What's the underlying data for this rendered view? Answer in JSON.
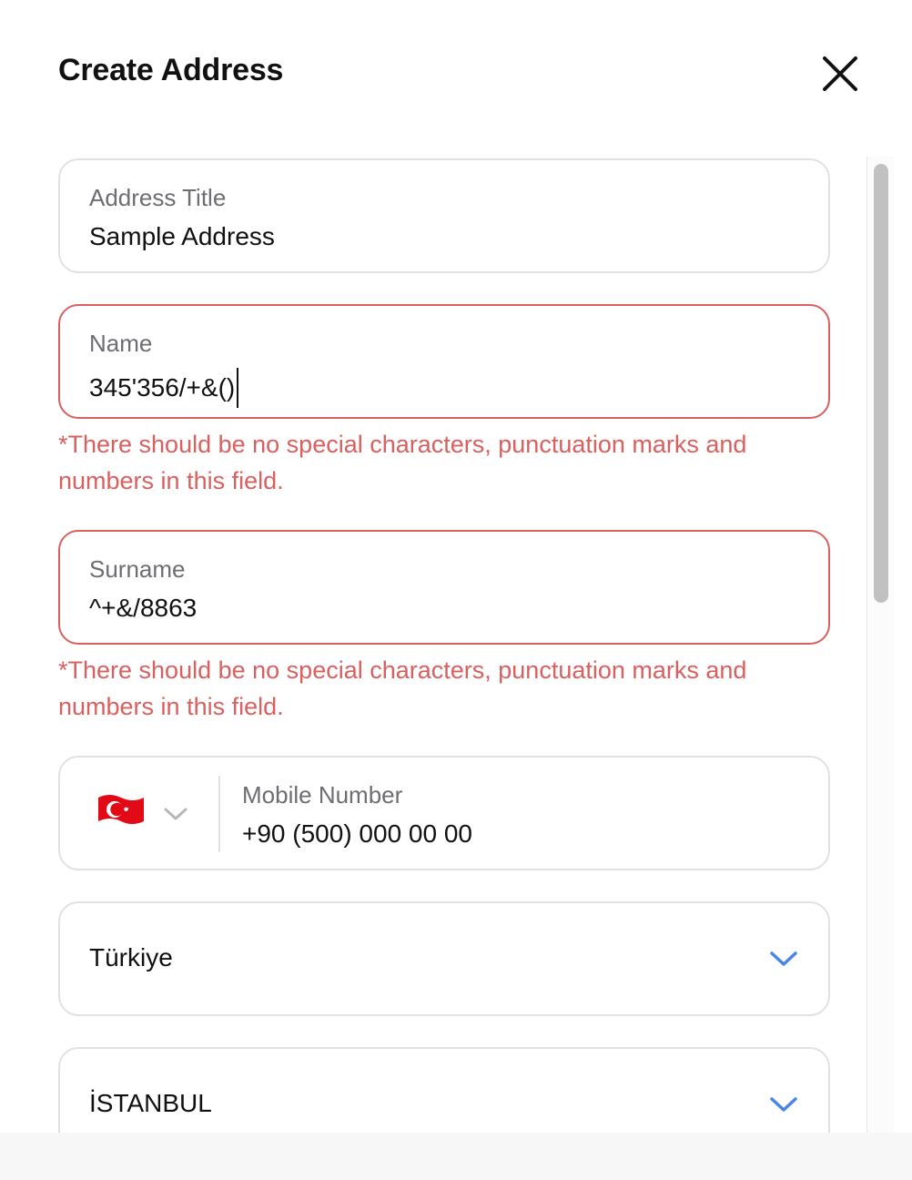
{
  "header": {
    "title": "Create Address"
  },
  "form": {
    "address_title": {
      "label": "Address Title",
      "value": "Sample Address"
    },
    "name": {
      "label": "Name",
      "value": "345'356/+&()",
      "error": "*There should be no special characters, punctuation marks and numbers in this field."
    },
    "surname": {
      "label": "Surname",
      "value": "^+&/8863",
      "error": "*There should be no special characters, punctuation marks and numbers in this field."
    },
    "mobile": {
      "label": "Mobile Number",
      "value": "+90 (500) 000 00 00",
      "flag_icon": "turkey-flag-icon"
    },
    "country": {
      "value": "Türkiye"
    },
    "city": {
      "value": "İSTANBUL"
    }
  },
  "colors": {
    "error": "#d9605f",
    "border": "#dfe1e5",
    "chevron_accent": "#4a86e8",
    "flag_red": "#e30a17"
  }
}
